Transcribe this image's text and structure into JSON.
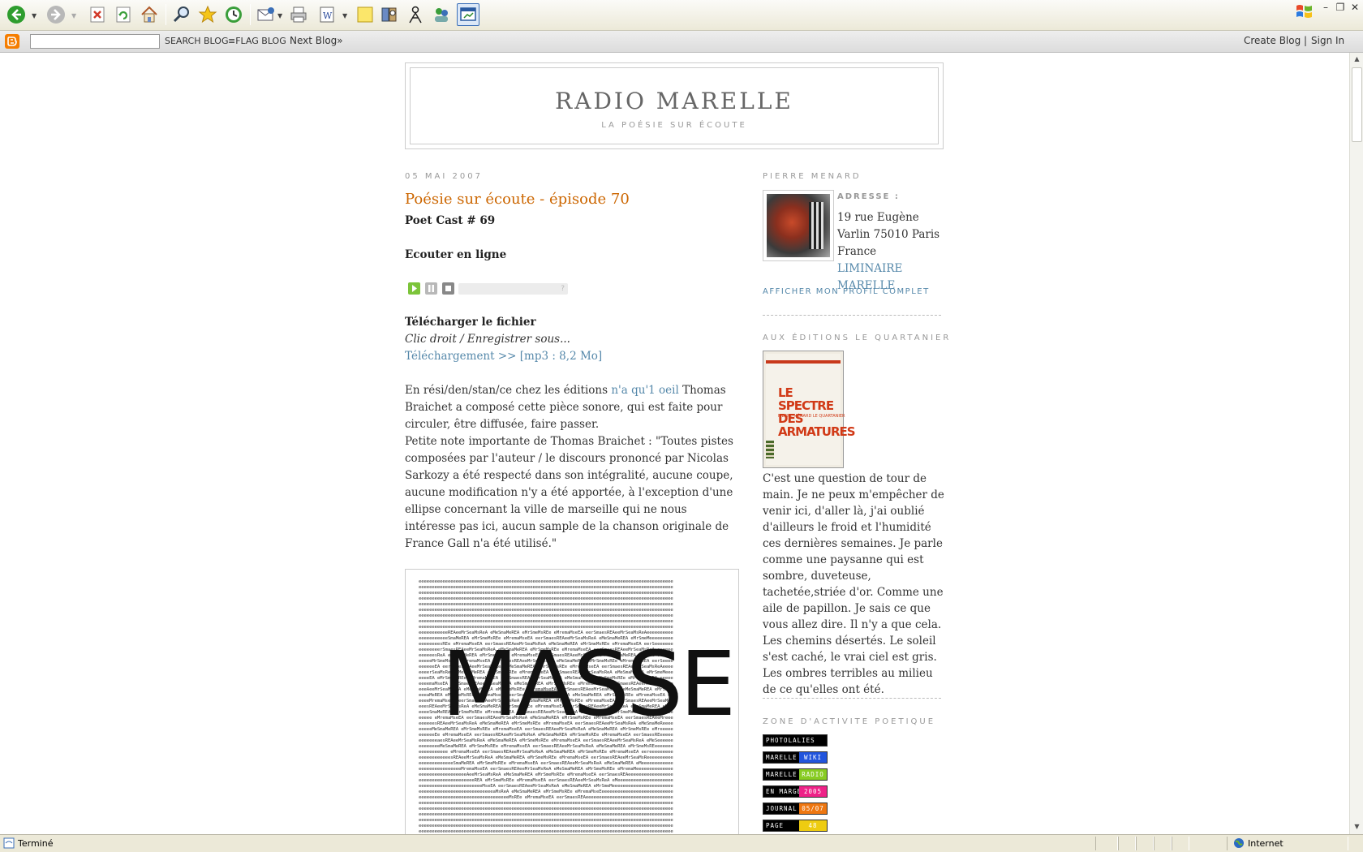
{
  "toolbar": {
    "buttons": [
      "back-icon",
      "forward-icon",
      "stop-icon",
      "refresh-icon",
      "home-icon",
      "search-icon",
      "favorites-icon",
      "history-icon",
      "mail-icon",
      "print-icon",
      "edit-icon",
      "notes-icon",
      "research-icon",
      "messenger-icon",
      "contacts-icon",
      "window-icon"
    ],
    "colors": {
      "back": "#2e9d2e",
      "stop": "#d23a2a",
      "refresh": "#3a9e3a",
      "accent": "#3b6fb7"
    }
  },
  "blogger_bar": {
    "search_button": "SEARCH BLOG",
    "flag_button": "≡FLAG BLOG",
    "next_blog": "Next Blog»",
    "create_blog": "Create Blog",
    "separator": "|",
    "sign_in": "Sign In"
  },
  "header": {
    "title": "RADIO MARELLE",
    "description": "LA POÉSIE SUR ÉCOUTE"
  },
  "post": {
    "date": "05 MAI 2007",
    "title": "Poésie sur écoute - épisode 70",
    "subtitle": "Poet Cast # 69",
    "listen_heading": "Ecouter en ligne",
    "player_help": "?",
    "download_heading": "Télécharger le fichier",
    "download_hint": "Clic droit / Enregistrer sous...",
    "download_link": "Téléchargement >> [mp3 : 8,2 Mo]",
    "body_p1_start": "En rési/den/stan/ce chez les éditions ",
    "body_p1_link": "n'a qu'1 oeil",
    "body_p1_end": " Thomas Braichet a composé cette pièce sonore, qui est faite pour circuler, être diffusée, faire passer.",
    "body_p2": "Petite note importante de Thomas Braichet : \"Toutes pistes composées par l'auteur / le discours prononcé par Nicolas Sarkozy a été respecté dans son intégralité, aucune coupe, aucune modification n'y a été apportée, à l'exception d'une ellipse concernant la ville de marseille qui ne nous intéresse pas ici, aucun sample de la chanson originale de France Gall n'a été utilisé.\"",
    "image_text": "MASSE"
  },
  "sidebar": {
    "profile_heading": "PIERRE MENARD",
    "address_label": "ADRESSE :",
    "address_text": "19 rue Eugène Varlin 75010 Paris France ",
    "address_link": "LIMINAIRE MARELLE",
    "profile_link": "AFFICHER MON PROFIL COMPLET",
    "book_heading": "AUX ÉDITIONS LE QUARTANIER",
    "book_title": "LE SPECTRE DES ARMATURES",
    "book_author": "PIERRE MÉNARD  LE QUARTANIER",
    "book_text": "C'est une question de tour de main. Je ne peux m'empêcher de venir ici, d'aller là, j'ai oublié d'ailleurs le froid et l'humidité ces dernières semaines. Je parle comme une paysanne qui est sombre, duveteuse, tachetée,striée d'or. Comme une aile de papillon. Je sais ce que vous allez dire. Il n'y a que cela. Les chemins désertés. Le soleil s'est caché, le vrai ciel est gris. Les ombres terribles au milieu de ce qu'elles ont été.",
    "zone_heading": "ZONE D'ACTIVITE POETIQUE",
    "zone_links": [
      {
        "left": "PHOTOLALIES",
        "right": "",
        "color": "#000000"
      },
      {
        "left": "MARELLE",
        "right": "WIKI",
        "color": "#2255dd"
      },
      {
        "left": "MARELLE",
        "right": "RADIO",
        "color": "#88cc22"
      },
      {
        "left": "EN MARGE",
        "right": "2005",
        "color": "#ee2288"
      },
      {
        "left": "JOURNAL",
        "right": "05/07",
        "color": "#ee7711"
      },
      {
        "left": "PAGE",
        "right": "48",
        "color": "#eecc11"
      }
    ]
  },
  "status_bar": {
    "status": "Terminé",
    "zone": "Internet"
  }
}
